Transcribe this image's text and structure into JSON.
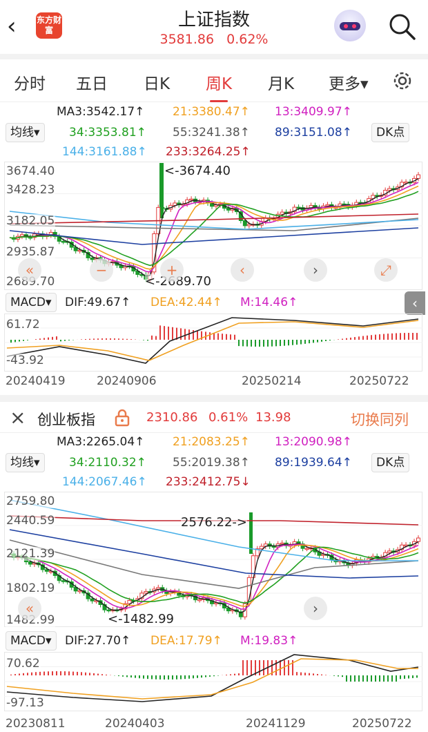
{
  "header": {
    "back_label": "‹",
    "logo_text": "东方财富",
    "title": "上证指数",
    "price": "3581.86",
    "change_pct": "0.62%"
  },
  "tabs": [
    {
      "label": "分时",
      "active": false
    },
    {
      "label": "五日",
      "active": false
    },
    {
      "label": "日K",
      "active": false
    },
    {
      "label": "周K",
      "active": true
    },
    {
      "label": "月K",
      "active": false
    },
    {
      "label": "更多▾",
      "active": false
    }
  ],
  "chart1": {
    "ma_button": "均线▾",
    "dk_button": "DK点",
    "ma": {
      "ma3": "MA3:3542.17↑",
      "ma21": "21:3380.47↑",
      "ma13": "13:3409.97↑",
      "ma34": "34:3353.81↑",
      "ma55": "55:3241.38↑",
      "ma89": "89:3151.08↑",
      "ma144": "144:3161.88↑",
      "ma233": "233:3264.25↑"
    },
    "y_labels": [
      "3674.40",
      "3428.23",
      "3182.05",
      "2935.87",
      "2689.70"
    ],
    "high_annotation": "<-3674.40",
    "low_annotation": "<-2689.70",
    "macd": {
      "label": "MACD▾",
      "dif": "DIF:49.67↑",
      "dea": "DEA:42.44↑",
      "m": "M:14.46↑",
      "top": "61.72",
      "bottom": "-43.92"
    },
    "dates": [
      "20240419",
      "20240906",
      "20250214",
      "20250722"
    ]
  },
  "section2": {
    "close_icon": "×",
    "name": "创业板指",
    "price": "2310.86",
    "change_pct": "0.61%",
    "change": "13.98",
    "switch_label": "切换同列"
  },
  "chart2": {
    "ma_button": "均线▾",
    "dk_button": "DK点",
    "ma": {
      "ma3": "MA3:2265.04↑",
      "ma21": "21:2083.25↑",
      "ma13": "13:2090.98↑",
      "ma34": "34:2110.32↑",
      "ma55": "55:2019.38↑",
      "ma89": "89:1939.64↑",
      "ma144": "144:2067.46↑",
      "ma233": "233:2412.75↓"
    },
    "y_labels": [
      "2759.80",
      "2440.59",
      "2121.39",
      "1802.19",
      "1482.99"
    ],
    "high_annotation": "2576.22->",
    "low_annotation": "<-1482.99",
    "macd": {
      "label": "MACD▾",
      "dif": "DIF:27.70↑",
      "dea": "DEA:17.79↑",
      "m": "M:19.83↑",
      "top": "70.62",
      "bottom": "-97.13"
    },
    "dates": [
      "20230811",
      "20240403",
      "20241129",
      "20250722"
    ]
  },
  "colors": {
    "up": "#e23b3b",
    "down": "#1a9a2a",
    "ma3": "#222222",
    "ma21": "#f0a020",
    "ma13": "#d020c0",
    "ma34": "#20a020",
    "ma55": "#777777",
    "ma89": "#1c3fa0",
    "ma144": "#4ab0e8",
    "ma233": "#c0202a",
    "accent": "#e23b3b",
    "orange": "#e97b4c"
  }
}
